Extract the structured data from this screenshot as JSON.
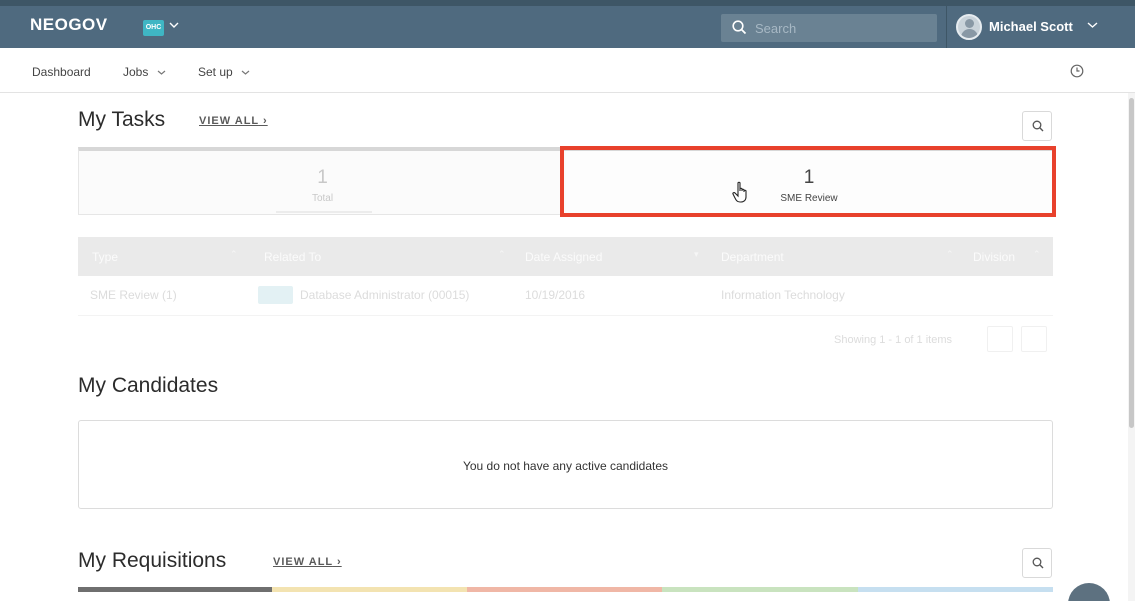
{
  "app": {
    "logo": "NEOGOV",
    "product_badge": "OHC"
  },
  "search": {
    "placeholder": "Search"
  },
  "user": {
    "name": "Michael Scott"
  },
  "nav": {
    "items": [
      "Dashboard",
      "Jobs",
      "Set up"
    ]
  },
  "tasks": {
    "title": "My Tasks",
    "view_all": "VIEW ALL",
    "tiles": [
      {
        "count": "1",
        "label": "Total"
      },
      {
        "count": "1",
        "label": "SME Review"
      }
    ],
    "columns": [
      "Type",
      "Related To",
      "Date Assigned",
      "Department",
      "Division"
    ],
    "rows": [
      {
        "type": "SME Review (1)",
        "related_to": "Database Administrator (00015)",
        "date_assigned": "10/19/2016",
        "department": "Information Technology",
        "division": ""
      }
    ],
    "pagination": "Showing 1 - 1 of 1 items"
  },
  "candidates": {
    "title": "My Candidates",
    "empty_message": "You do not have any active candidates"
  },
  "requisitions": {
    "title": "My Requisitions",
    "view_all": "VIEW ALL",
    "status_colors": [
      "#6f6f6f",
      "#f3e3b1",
      "#f0b7a6",
      "#c9e3bf",
      "#c6dff0"
    ]
  },
  "colors": {
    "header": "#4f6a7f",
    "highlight": "#e8412c",
    "badge": "#3fb6c4"
  }
}
